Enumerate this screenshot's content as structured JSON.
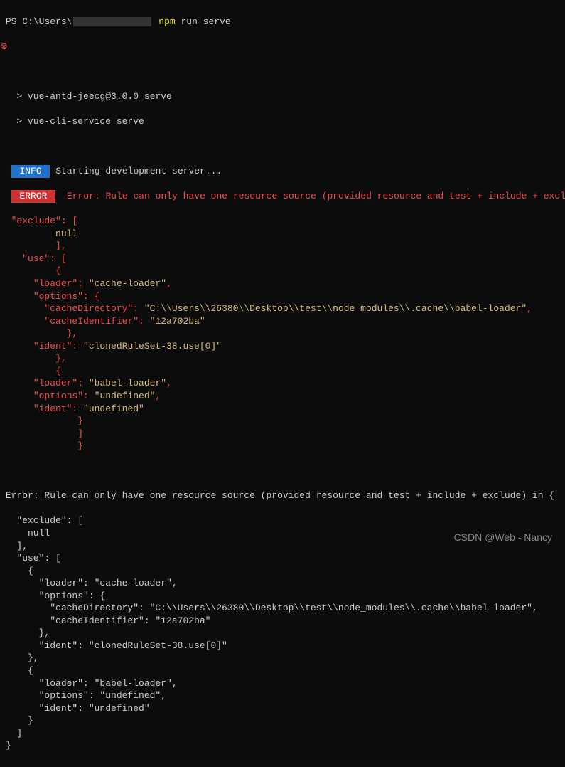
{
  "prompt": {
    "ps": "PS",
    "path_prefix": "C:\\Users\\",
    "cmd_part1": "npm",
    "cmd_part2": " run serve"
  },
  "err_marker": "⊗",
  "script_lines": [
    "> vue-antd-jeecg@3.0.0 serve",
    "> vue-cli-service serve"
  ],
  "info_badge": " INFO ",
  "info_text": " Starting development server...",
  "error_badge": " ERROR ",
  "error_text": " Error: Rule can only have one resource source (provided resource and test + include + exclude) in {",
  "colored_block": [
    {
      "indent": "  ",
      "key": "\"exclude\"",
      "after": ": ["
    },
    {
      "indent": "          ",
      "val": "null"
    },
    {
      "indent": "          ",
      "brace": "],"
    },
    {
      "indent": "    ",
      "key": "\"use\"",
      "after": ": ["
    },
    {
      "indent": "          ",
      "brace": "{"
    },
    {
      "indent": "      ",
      "key": "\"loader\"",
      "after": ": ",
      "str": "\"cache-loader\"",
      "after2": ","
    },
    {
      "indent": "      ",
      "key": "\"options\"",
      "after": ": {"
    },
    {
      "indent": "        ",
      "key": "\"cacheDirectory\"",
      "after": ": ",
      "str": "\"C:\\\\Users\\\\26380\\\\Desktop\\\\test\\\\node_modules\\\\.cache\\\\babel-loader\"",
      "after2": ","
    },
    {
      "indent": "        ",
      "key": "\"cacheIdentifier\"",
      "after": ": ",
      "str": "\"12a702ba\""
    },
    {
      "indent": "            ",
      "brace": "},"
    },
    {
      "indent": "      ",
      "key": "\"ident\"",
      "after": ": ",
      "str": "\"clonedRuleSet-38.use[0]\""
    },
    {
      "indent": "          ",
      "brace": "},"
    },
    {
      "indent": "          ",
      "brace": "{"
    },
    {
      "indent": "      ",
      "key": "\"loader\"",
      "after": ": ",
      "str": "\"babel-loader\"",
      "after2": ","
    },
    {
      "indent": "      ",
      "key": "\"options\"",
      "after": ": ",
      "str": "\"undefined\"",
      "after2": ","
    },
    {
      "indent": "      ",
      "key": "\"ident\"",
      "after": ": ",
      "str": "\"undefined\""
    },
    {
      "indent": "              ",
      "brace": "}"
    },
    {
      "indent": "              ",
      "brace": "]"
    },
    {
      "indent": "              ",
      "brace": "}"
    }
  ],
  "plain_error_header": "Error: Rule can only have one resource source (provided resource and test + include + exclude) in {",
  "plain_block": [
    "  \"exclude\": [",
    "    null",
    "  ],",
    "  \"use\": [",
    "    {",
    "      \"loader\": \"cache-loader\",",
    "      \"options\": {",
    "        \"cacheDirectory\": \"C:\\\\Users\\\\26380\\\\Desktop\\\\test\\\\node_modules\\\\.cache\\\\babel-loader\",",
    "        \"cacheIdentifier\": \"12a702ba\"",
    "      },",
    "      \"ident\": \"clonedRuleSet-38.use[0]\"",
    "    },",
    "    {",
    "      \"loader\": \"babel-loader\",",
    "      \"options\": \"undefined\",",
    "      \"ident\": \"undefined\"",
    "    }",
    "  ]",
    "}"
  ],
  "watermark": "CSDN @Web - Nancy"
}
